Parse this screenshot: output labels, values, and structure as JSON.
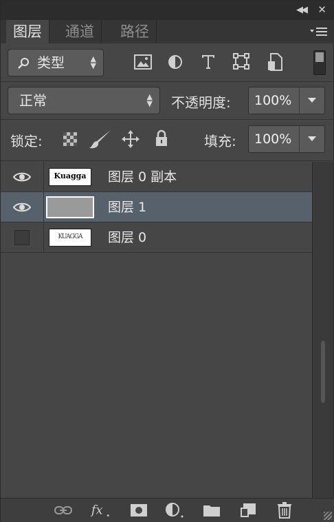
{
  "tabs": [
    {
      "label": "图层",
      "active": true
    },
    {
      "label": "通道",
      "active": false
    },
    {
      "label": "路径",
      "active": false
    }
  ],
  "filter": {
    "label": "类型"
  },
  "blend_mode": {
    "value": "正常"
  },
  "opacity": {
    "label": "不透明度:",
    "value": "100%"
  },
  "lock": {
    "label": "锁定:"
  },
  "fill": {
    "label": "填充:",
    "value": "100%"
  },
  "layers": [
    {
      "name": "图层 0 副本",
      "visible": true,
      "selected": false
    },
    {
      "name": "图层 1",
      "visible": true,
      "selected": true
    },
    {
      "name": "图层 0",
      "visible": false,
      "selected": false
    }
  ],
  "thumb_text": {
    "layer0copy": "Kuagga",
    "layer0": "KUAGGA"
  },
  "colors": {
    "panel": "#464646",
    "selected_row": "#57616b",
    "tab_bar": "#353535"
  }
}
